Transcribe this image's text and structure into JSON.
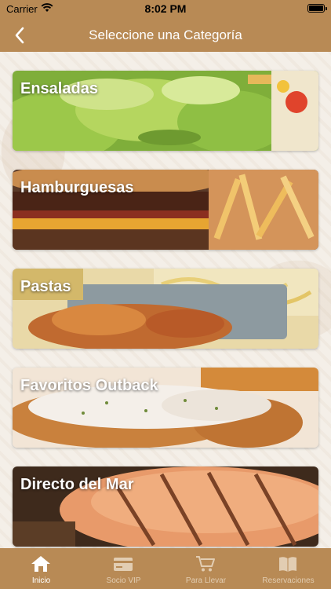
{
  "status_bar": {
    "carrier": "Carrier",
    "time": "8:02 PM"
  },
  "nav": {
    "back_icon": "chevron-left-icon",
    "title": "Seleccione una Categoría"
  },
  "categories": [
    {
      "label": "Ensaladas"
    },
    {
      "label": "Hamburguesas"
    },
    {
      "label": "Pastas"
    },
    {
      "label": "Favoritos Outback"
    },
    {
      "label": "Directo del Mar"
    }
  ],
  "tabs": [
    {
      "label": "Inicio",
      "icon": "home-icon",
      "active": true
    },
    {
      "label": "Socio VIP",
      "icon": "card-icon",
      "active": false
    },
    {
      "label": "Para Llevar",
      "icon": "cart-icon",
      "active": false
    },
    {
      "label": "Reservaciones",
      "icon": "book-icon",
      "active": false
    }
  ],
  "colors": {
    "brand": "#b88a55",
    "tab_active": "#ffffff",
    "tab_inactive": "#e2cdb2"
  }
}
